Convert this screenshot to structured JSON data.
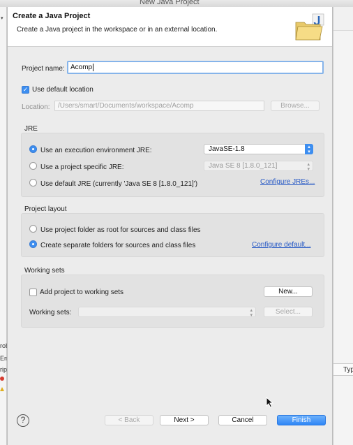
{
  "window": {
    "title": "New Java Project"
  },
  "background": {
    "left_sliver_texts": [
      "rob",
      "Err",
      "rip",
      "E",
      "W"
    ]
  },
  "background_right": {
    "column_header": "Typ"
  },
  "banner": {
    "title": "Create a Java Project",
    "description": "Create a Java project in the workspace or in an external location.",
    "icon": "java-project-folder-icon"
  },
  "project_name": {
    "label": "Project name:",
    "value": "Acomp"
  },
  "default_location": {
    "label": "Use default location",
    "checked": true
  },
  "location": {
    "label": "Location:",
    "value": "/Users/smart/Documents/workspace/Acomp",
    "browse_label": "Browse..."
  },
  "jre": {
    "title": "JRE",
    "env_label": "Use an execution environment JRE:",
    "env_value": "JavaSE-1.8",
    "specific_label": "Use a project specific JRE:",
    "specific_value": "Java SE 8 [1.8.0_121]",
    "default_label": "Use default JRE (currently 'Java SE 8 [1.8.0_121]')",
    "configure_link": "Configure JREs...",
    "selected": "env"
  },
  "layout": {
    "title": "Project layout",
    "option_root": "Use project folder as root for sources and class files",
    "option_separate": "Create separate folders for sources and class files",
    "configure_link": "Configure default...",
    "selected": "separate"
  },
  "working_sets": {
    "title": "Working sets",
    "add_label": "Add project to working sets",
    "add_checked": false,
    "new_label": "New...",
    "sets_label": "Working sets:",
    "sets_value": "",
    "select_label": "Select..."
  },
  "footer": {
    "help_symbol": "?",
    "back_label": "< Back",
    "next_label": "Next >",
    "cancel_label": "Cancel",
    "finish_label": "Finish"
  },
  "colors": {
    "accent": "#3d8ef0",
    "link": "#2457c5",
    "default_button": "#2f86f6"
  }
}
